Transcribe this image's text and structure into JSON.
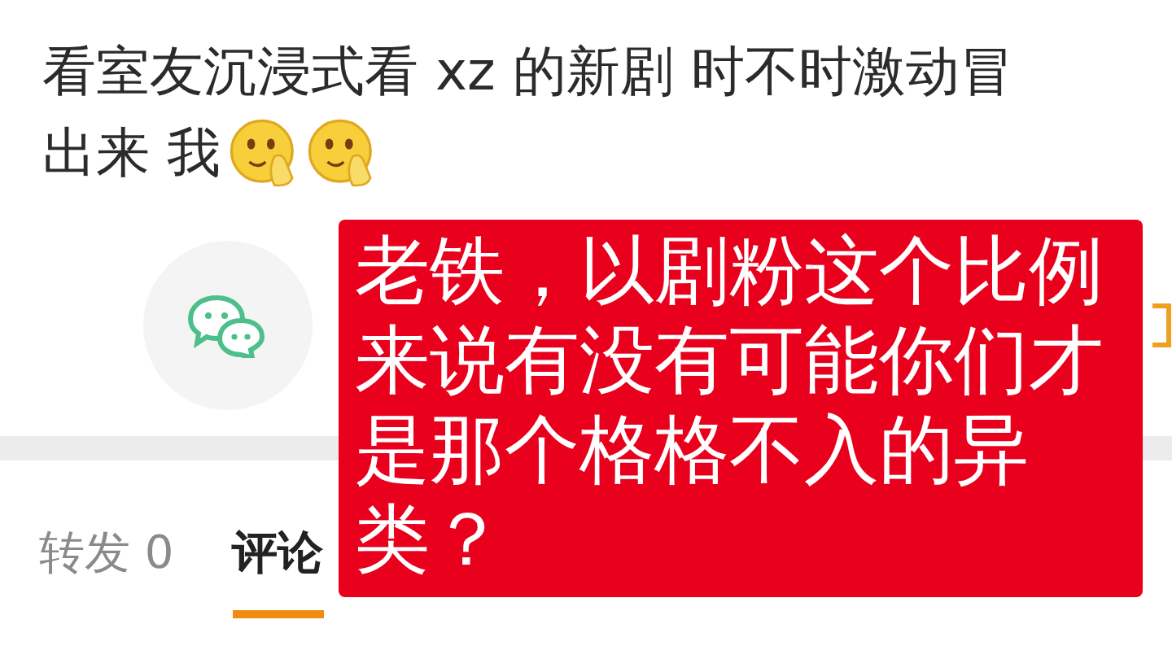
{
  "post": {
    "lines": [
      "看室友沉浸式看 xz 的新剧  时不时激动冒",
      "出来 我"
    ]
  },
  "tabs": [
    {
      "label": "转发 0",
      "selected": false
    },
    {
      "label": "评论",
      "selected": true
    }
  ],
  "overlay": {
    "text": "老铁，以剧粉这个比例来说有没有可能你们才是那个格格不入的异类？"
  }
}
